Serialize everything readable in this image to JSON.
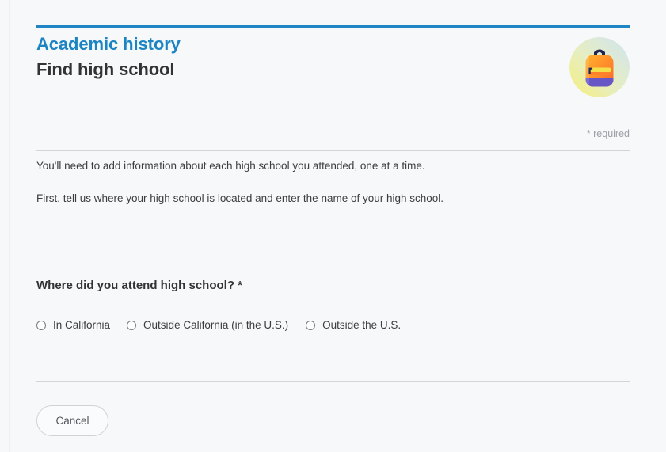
{
  "theme": {
    "page_background": "#f7f8fa",
    "accent_blue": "#1f86c3",
    "eyebrow_color": "#1b84c2",
    "title_color": "#333333",
    "body_text_color": "#3d3d3d",
    "muted_text_color": "#9b9fa6",
    "rule_color": "#d2d4d8",
    "button_border_color": "#cfd2d6"
  },
  "header": {
    "eyebrow": "Academic history",
    "title": "Find high school",
    "badge_icon": "backpack-icon"
  },
  "required_note": "* required",
  "intro": {
    "paragraph_1": "You'll need to add information about each high school you attended, one at a time.",
    "paragraph_2": "First, tell us where your high school is located and enter the name of your high school."
  },
  "question": {
    "label": "Where did you attend high school? *",
    "options": [
      {
        "label": "In California",
        "selected": false
      },
      {
        "label": "Outside California (in the U.S.)",
        "selected": false
      },
      {
        "label": "Outside the U.S.",
        "selected": false
      }
    ]
  },
  "footer": {
    "cancel_label": "Cancel"
  }
}
